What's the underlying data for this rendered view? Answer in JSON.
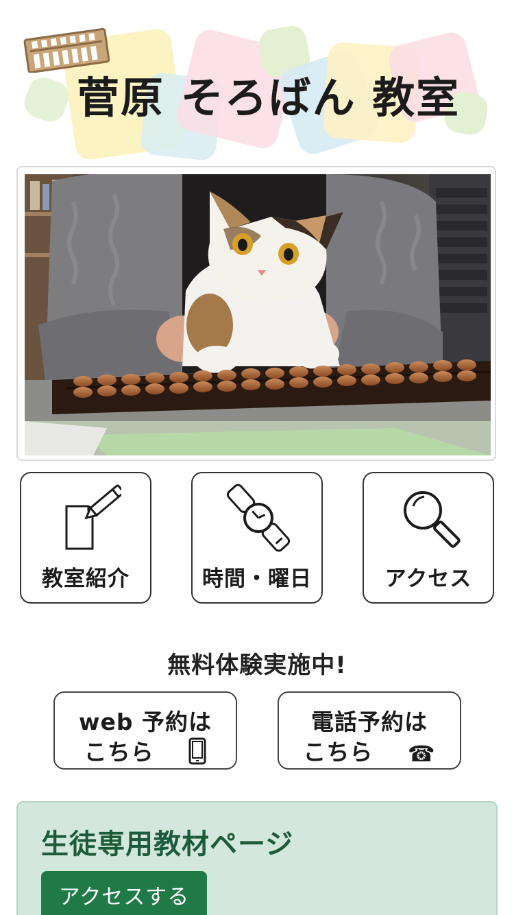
{
  "logo": {
    "title": "菅原 そろばん 教室"
  },
  "nav": [
    {
      "label": "教室紹介",
      "icon": "document-pencil-icon"
    },
    {
      "label": "時間・曜日",
      "icon": "wristwatch-icon"
    },
    {
      "label": "アクセス",
      "icon": "magnifier-icon"
    }
  ],
  "trial": {
    "heading": "無料体験実施中!",
    "web": {
      "line1": "web 予約は",
      "line2": "こちら",
      "icon": "smartphone-icon"
    },
    "phone": {
      "line1": "電話予約は",
      "line2": "こちら",
      "icon": "telephone-icon",
      "glyph": "☎"
    }
  },
  "student": {
    "title": "生徒専用教材ページ",
    "button": "アクセスする",
    "accent": "#1f7a46",
    "background": "#d4e7dc"
  }
}
